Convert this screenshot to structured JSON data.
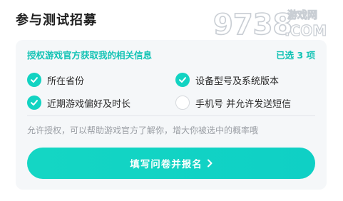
{
  "header": {
    "title": "参与测试招募"
  },
  "watermark": {
    "digits": "9738",
    "text_top": "游戏网",
    "text_bottom": ".COM"
  },
  "card": {
    "auth_label": "授权游戏官方获取我的相关信息",
    "selected_count": "已选 3 项",
    "options": [
      {
        "label": "所在省份",
        "checked": true
      },
      {
        "label": "设备型号及系统版本",
        "checked": true
      },
      {
        "label": "近期游戏偏好及时长",
        "checked": true
      },
      {
        "label": "手机号 并允许发送短信",
        "checked": false
      }
    ],
    "hint": "允许授权，可以帮助游戏官方了解你，增大你被选中的概率哦",
    "cta_label": "填写问卷并报名"
  },
  "colors": {
    "accent": "#12d3c2",
    "title": "#1f1f1f",
    "hint": "#9a9ea4",
    "card_bg": "#f5f7f9"
  }
}
